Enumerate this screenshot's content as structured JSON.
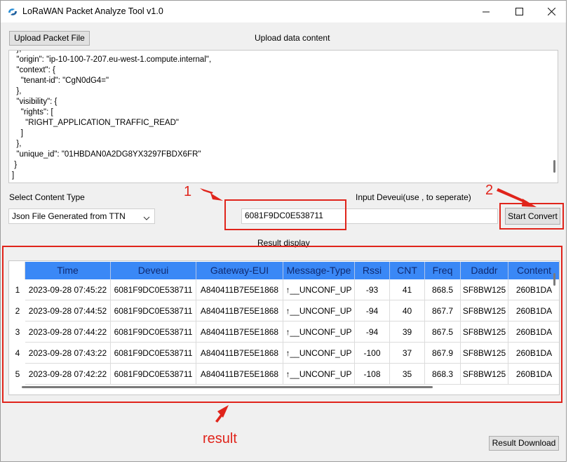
{
  "window": {
    "title": "LoRaWAN Packet Analyze Tool v1.0"
  },
  "toolbar": {
    "upload_label": "Upload Packet File",
    "upload_content_label": "Upload data content"
  },
  "json_lines": [
    "  },",
    "  \"origin\": \"ip-10-100-7-207.eu-west-1.compute.internal\",",
    "  \"context\": {",
    "    \"tenant-id\": \"CgN0dG4=\"",
    "  },",
    "  \"visibility\": {",
    "    \"rights\": [",
    "      \"RIGHT_APPLICATION_TRAFFIC_READ\"",
    "    ]",
    "  },",
    "  \"unique_id\": \"01HBDAN0A2DG8YX3297FBDX6FR\"",
    " }",
    "]"
  ],
  "content_type": {
    "label": "Select Content Type",
    "selected": "Json File Generated from TTN"
  },
  "deveui_input": {
    "label": "Input Deveui(use , to seperate)",
    "value": "6081F9DC0E538711"
  },
  "convert_button": "Start Convert",
  "result_label": "Result display",
  "table": {
    "columns": [
      "Time",
      "Deveui",
      "Gateway-EUI",
      "Message-Type",
      "Rssi",
      "CNT",
      "Freq",
      "Daddr",
      "Content"
    ],
    "rows": [
      {
        "n": "1",
        "cells": [
          "2023-09-28 07:45:22",
          "6081F9DC0E538711",
          "A840411B7E5E1868",
          "↑__UNCONF_UP",
          "-93",
          "41",
          "868.5",
          "SF8BW125",
          "260B1DA"
        ]
      },
      {
        "n": "2",
        "cells": [
          "2023-09-28 07:44:52",
          "6081F9DC0E538711",
          "A840411B7E5E1868",
          "↑__UNCONF_UP",
          "-94",
          "40",
          "867.7",
          "SF8BW125",
          "260B1DA"
        ]
      },
      {
        "n": "3",
        "cells": [
          "2023-09-28 07:44:22",
          "6081F9DC0E538711",
          "A840411B7E5E1868",
          "↑__UNCONF_UP",
          "-94",
          "39",
          "867.5",
          "SF8BW125",
          "260B1DA"
        ]
      },
      {
        "n": "4",
        "cells": [
          "2023-09-28 07:43:22",
          "6081F9DC0E538711",
          "A840411B7E5E1868",
          "↑__UNCONF_UP",
          "-100",
          "37",
          "867.9",
          "SF8BW125",
          "260B1DA"
        ]
      },
      {
        "n": "5",
        "cells": [
          "2023-09-28 07:42:22",
          "6081F9DC0E538711",
          "A840411B7E5E1868",
          "↑__UNCONF_UP",
          "-108",
          "35",
          "868.3",
          "SF8BW125",
          "260B1DA"
        ]
      }
    ]
  },
  "download_button": "Result Download",
  "annotations": {
    "marker_1": "1",
    "marker_2": "2",
    "result_text": "result"
  },
  "colors": {
    "header_bg": "#3a88f6",
    "header_text": "#102a70",
    "annotation_red": "#e0241b",
    "window_bg": "#f0f0f0"
  },
  "icons": [
    "app-logo-icon",
    "minimize-icon",
    "maximize-icon",
    "close-icon",
    "chevron-down-icon",
    "arrow-annotation-icon"
  ]
}
